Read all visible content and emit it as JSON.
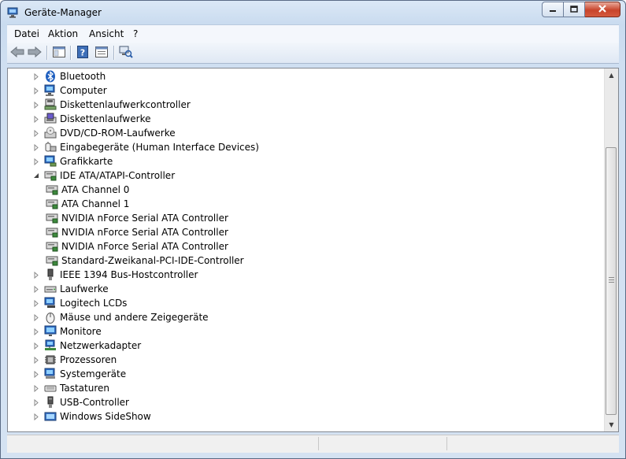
{
  "window": {
    "title": "Geräte-Manager"
  },
  "menu": {
    "items": [
      "Datei",
      "Aktion",
      "Ansicht",
      "?"
    ]
  },
  "toolbar": {
    "buttons": [
      "back-icon",
      "forward-icon",
      "console-tree-icon",
      "help-icon",
      "properties-icon",
      "scan-hardware-icon"
    ]
  },
  "tree": {
    "items": [
      {
        "label": "Bluetooth",
        "level": 0,
        "expanded": false,
        "icon": "bluetooth-icon"
      },
      {
        "label": "Computer",
        "level": 0,
        "expanded": false,
        "icon": "computer-icon"
      },
      {
        "label": "Diskettenlaufwerkcontroller",
        "level": 0,
        "expanded": false,
        "icon": "floppy-controller-icon"
      },
      {
        "label": "Diskettenlaufwerke",
        "level": 0,
        "expanded": false,
        "icon": "floppy-drive-icon"
      },
      {
        "label": "DVD/CD-ROM-Laufwerke",
        "level": 0,
        "expanded": false,
        "icon": "dvd-drive-icon"
      },
      {
        "label": "Eingabegeräte (Human Interface Devices)",
        "level": 0,
        "expanded": false,
        "icon": "hid-icon"
      },
      {
        "label": "Grafikkarte",
        "level": 0,
        "expanded": false,
        "icon": "display-adapter-icon"
      },
      {
        "label": "IDE ATA/ATAPI-Controller",
        "level": 0,
        "expanded": true,
        "icon": "ide-controller-icon"
      },
      {
        "label": "ATA Channel 0",
        "level": 1,
        "icon": "ide-controller-icon"
      },
      {
        "label": "ATA Channel 1",
        "level": 1,
        "icon": "ide-controller-icon"
      },
      {
        "label": "NVIDIA nForce Serial ATA Controller",
        "level": 1,
        "icon": "ide-controller-icon"
      },
      {
        "label": "NVIDIA nForce Serial ATA Controller",
        "level": 1,
        "icon": "ide-controller-icon"
      },
      {
        "label": "NVIDIA nForce Serial ATA Controller",
        "level": 1,
        "icon": "ide-controller-icon"
      },
      {
        "label": "Standard-Zweikanal-PCI-IDE-Controller",
        "level": 1,
        "icon": "ide-controller-icon"
      },
      {
        "label": "IEEE 1394 Bus-Hostcontroller",
        "level": 0,
        "expanded": false,
        "icon": "firewire-icon"
      },
      {
        "label": "Laufwerke",
        "level": 0,
        "expanded": false,
        "icon": "disk-drive-icon"
      },
      {
        "label": "Logitech LCDs",
        "level": 0,
        "expanded": false,
        "icon": "lcd-icon"
      },
      {
        "label": "Mäuse und andere Zeigegeräte",
        "level": 0,
        "expanded": false,
        "icon": "mouse-icon"
      },
      {
        "label": "Monitore",
        "level": 0,
        "expanded": false,
        "icon": "monitor-icon"
      },
      {
        "label": "Netzwerkadapter",
        "level": 0,
        "expanded": false,
        "icon": "network-adapter-icon"
      },
      {
        "label": "Prozessoren",
        "level": 0,
        "expanded": false,
        "icon": "processor-icon"
      },
      {
        "label": "Systemgeräte",
        "level": 0,
        "expanded": false,
        "icon": "system-devices-icon"
      },
      {
        "label": "Tastaturen",
        "level": 0,
        "expanded": false,
        "icon": "keyboard-icon"
      },
      {
        "label": "USB-Controller",
        "level": 0,
        "expanded": false,
        "icon": "usb-icon"
      },
      {
        "label": "Windows SideShow",
        "level": 0,
        "expanded": false,
        "icon": "sideshow-icon"
      }
    ]
  },
  "colors": {
    "title_bar": "#cfdff1",
    "close_button": "#c8442b",
    "selection_text": "#000000"
  }
}
